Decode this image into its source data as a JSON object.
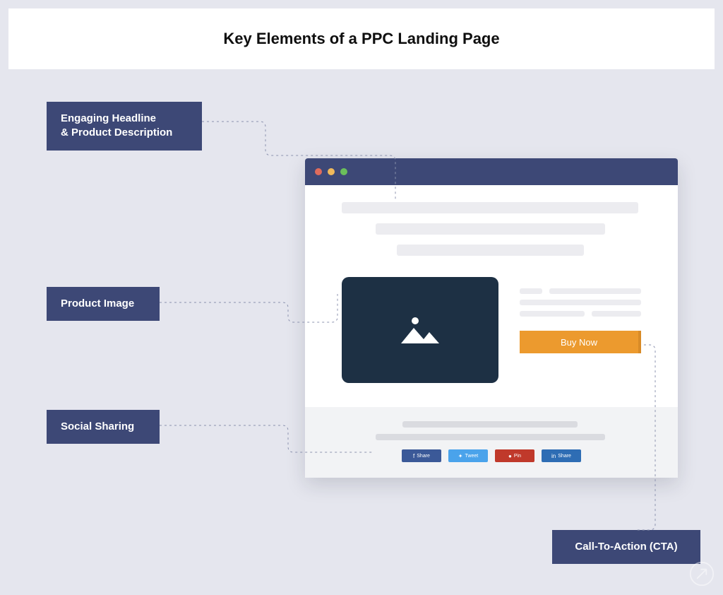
{
  "title": "Key Elements of a PPC Landing Page",
  "labels": {
    "headline": "Engaging Headline\n& Product Description",
    "product_image": "Product Image",
    "social_sharing": "Social Sharing",
    "cta": "Call-To-Action (CTA)"
  },
  "browser": {
    "cta_button": "Buy Now",
    "share_buttons": {
      "facebook": "Share",
      "twitter": "Tweet",
      "pinterest": "Pin",
      "linkedin": "Share"
    }
  },
  "colors": {
    "label_bg": "#3d4876",
    "cta_bg": "#ec9a2e",
    "browser_bar": "#3d4876",
    "product_block": "#1d3044",
    "page_bg": "#e5e6ee"
  }
}
